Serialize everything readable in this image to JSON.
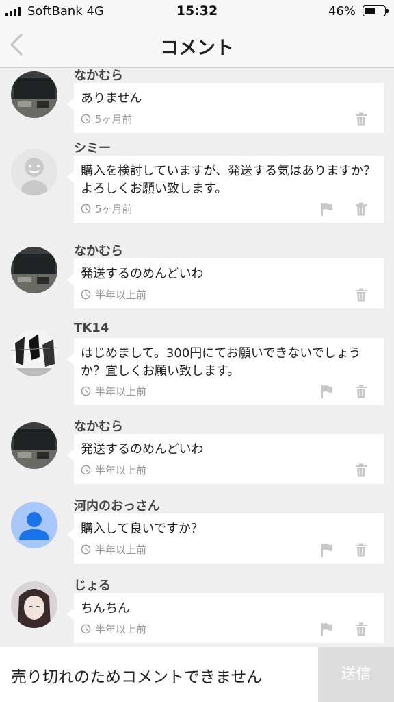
{
  "status_bar": {
    "carrier": "SoftBank 4G",
    "time": "15:32",
    "battery": "46%"
  },
  "nav": {
    "title": "コメント"
  },
  "comments": [
    {
      "user": "なかむら",
      "text": "ありません",
      "time": "5ヶ月前",
      "avatar": "photo-desk",
      "flag": false
    },
    {
      "user": "シミー",
      "text": "購入を検討していますが、発送する気はありますか？よろしくお願い致します。",
      "time": "5ヶ月前",
      "avatar": "default-gray",
      "flag": true
    },
    {
      "user": "なかむら",
      "text": "発送するのめんどいわ",
      "time": "半年以上前",
      "avatar": "photo-desk",
      "flag": false
    },
    {
      "user": "TK14",
      "text": "はじめまして。300円にてお願いできないでしょうか？宜しくお願い致します。",
      "time": "半年以上前",
      "avatar": "manga",
      "flag": true
    },
    {
      "user": "なかむら",
      "text": "発送するのめんどいわ",
      "time": "半年以上前",
      "avatar": "photo-desk",
      "flag": false
    },
    {
      "user": "河内のおっさん",
      "text": "購入して良いですか？",
      "time": "半年以上前",
      "avatar": "default-blue",
      "flag": true
    },
    {
      "user": "じょる",
      "text": "ちんちん",
      "time": "半年以上前",
      "avatar": "anime",
      "flag": true
    }
  ],
  "footer": {
    "closed_message": "売り切れのためコメントできません",
    "send_label": "送信"
  },
  "colors": {
    "background": "#efefef",
    "bubble": "#ffffff",
    "send_disabled": "#dddddd",
    "default_avatar_blue": "#a8c7fa"
  }
}
